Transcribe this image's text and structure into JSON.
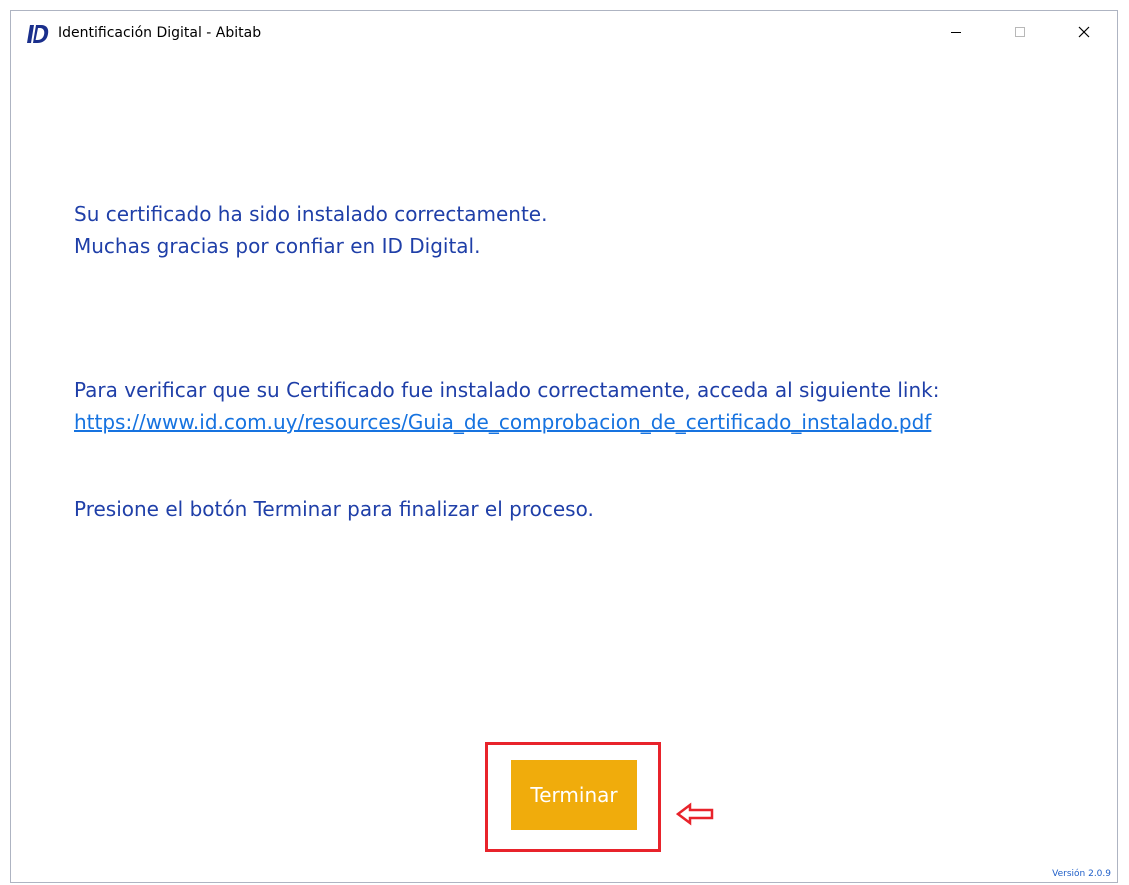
{
  "window": {
    "title": "Identificación Digital - Abitab",
    "logo_icon": "id-logo-icon",
    "controls": {
      "minimize_icon": "minimize-icon",
      "maximize_icon": "maximize-icon",
      "close_icon": "close-icon"
    }
  },
  "main": {
    "success_line1": "Su certificado ha sido instalado correctamente.",
    "success_line2": "Muchas gracias por confiar en ID Digital.",
    "verify_text": "Para verificar que su Certificado fue instalado correctamente, acceda al siguiente link:",
    "verify_link": "https://www.id.com.uy/resources/Guia_de_comprobacion_de_certificado_instalado.pdf",
    "finish_instruction": "Presione el botón Terminar para finalizar el proceso."
  },
  "footer": {
    "finish_button_label": "Terminar",
    "version": "Versión 2.0.9"
  },
  "annotation": {
    "arrow_icon": "left-arrow-icon"
  },
  "colors": {
    "text_blue": "#1f3fa8",
    "link_blue": "#1673e0",
    "button_orange": "#f0ac0c",
    "highlight_red": "#e8232b"
  }
}
